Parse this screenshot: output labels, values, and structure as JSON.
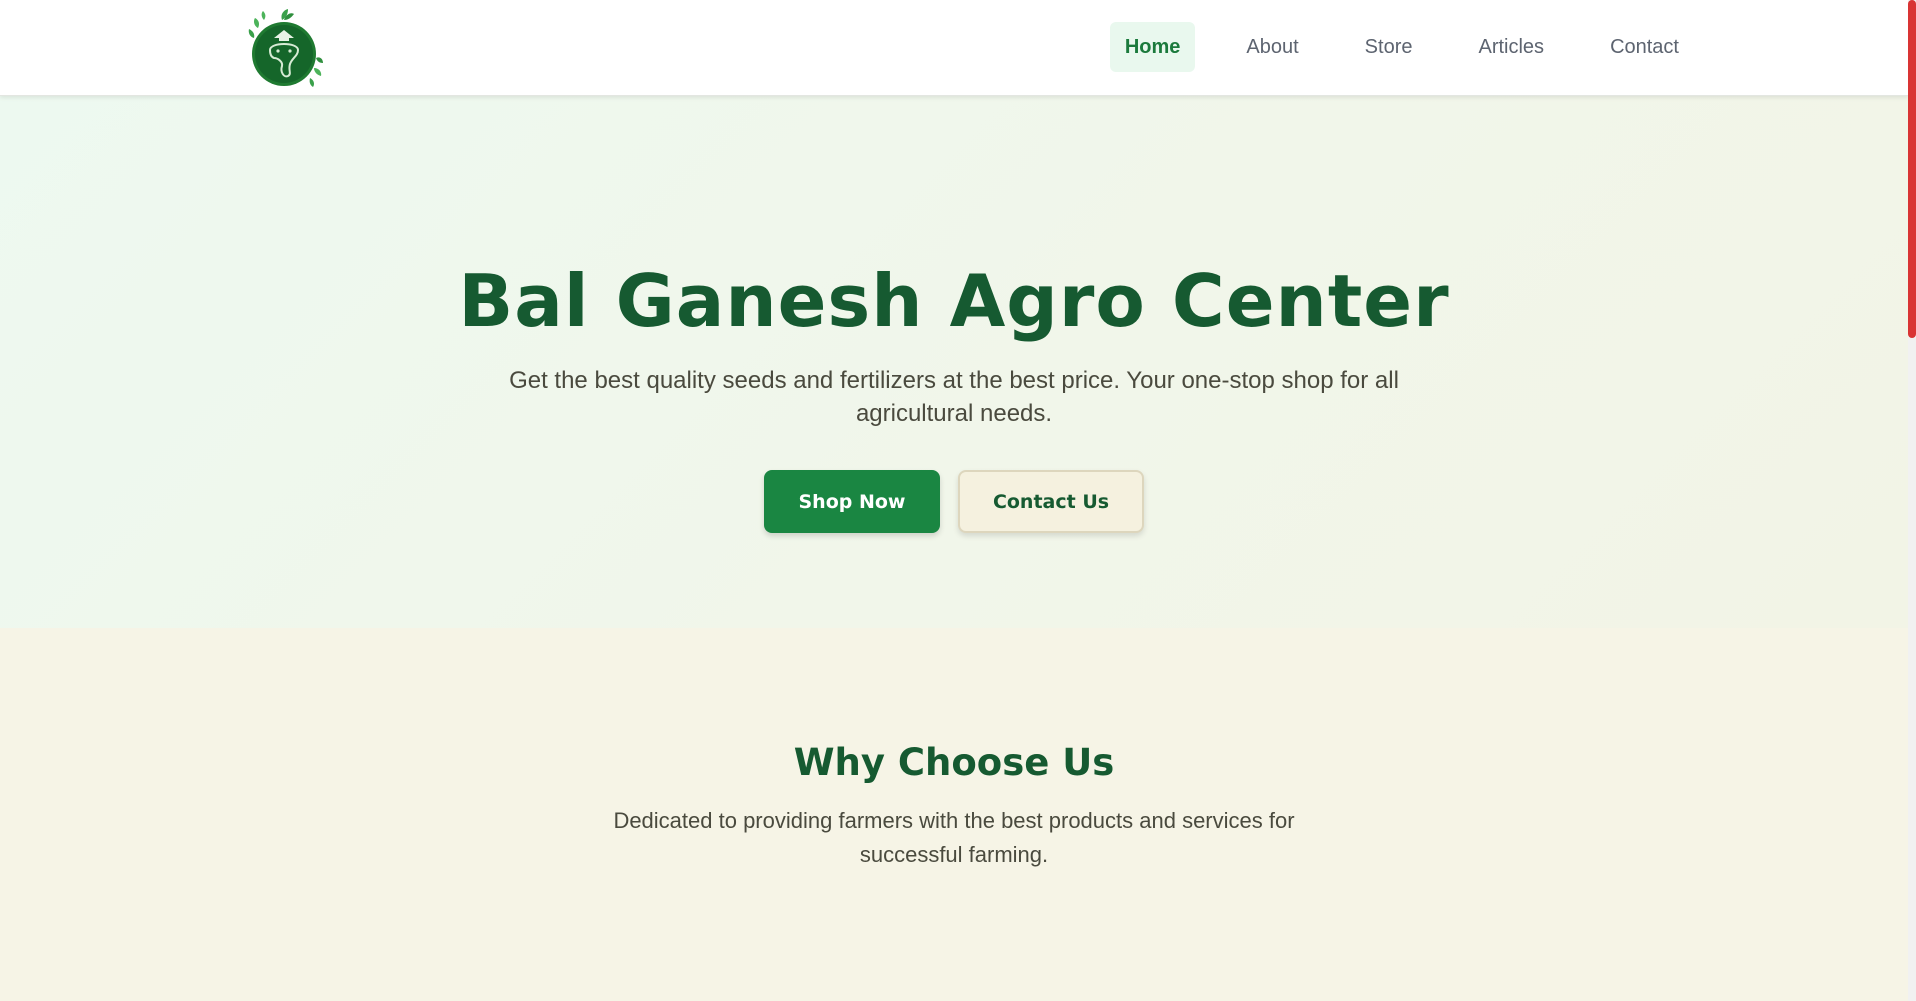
{
  "header": {
    "logo_icon": "ganesha-leaf-logo-icon",
    "nav": [
      {
        "label": "Home",
        "active": true
      },
      {
        "label": "About",
        "active": false
      },
      {
        "label": "Store",
        "active": false
      },
      {
        "label": "Articles",
        "active": false
      },
      {
        "label": "Contact",
        "active": false
      }
    ]
  },
  "hero": {
    "title": "Bal Ganesh Agro Center",
    "subtitle": "Get the best quality seeds and fertilizers at the best price. Your one-stop shop for all agricultural needs.",
    "primary_button": "Shop Now",
    "secondary_button": "Contact Us"
  },
  "why": {
    "title": "Why Choose Us",
    "subtitle": "Dedicated to providing farmers with the best products and services for successful farming."
  },
  "colors": {
    "brand_green": "#165a31",
    "button_green": "#1a8642",
    "active_nav_bg": "#e9f8ee",
    "cream": "#f6f4e6",
    "scroll_thumb": "#d93434"
  }
}
